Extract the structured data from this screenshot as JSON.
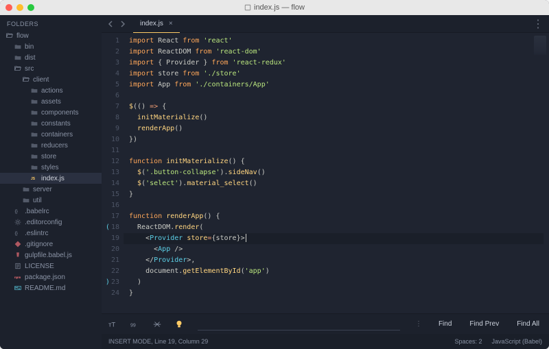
{
  "window": {
    "title": "index.js — flow"
  },
  "sidebar": {
    "header": "FOLDERS",
    "items": [
      {
        "label": "flow",
        "icon": "folder-open",
        "depth": 0,
        "sel": false
      },
      {
        "label": "bin",
        "icon": "folder",
        "depth": 1,
        "sel": false
      },
      {
        "label": "dist",
        "icon": "folder",
        "depth": 1,
        "sel": false
      },
      {
        "label": "src",
        "icon": "folder-open",
        "depth": 1,
        "sel": false
      },
      {
        "label": "client",
        "icon": "folder-open",
        "depth": 2,
        "sel": false
      },
      {
        "label": "actions",
        "icon": "folder",
        "depth": 3,
        "sel": false
      },
      {
        "label": "assets",
        "icon": "folder",
        "depth": 3,
        "sel": false
      },
      {
        "label": "components",
        "icon": "folder",
        "depth": 3,
        "sel": false
      },
      {
        "label": "constants",
        "icon": "folder",
        "depth": 3,
        "sel": false
      },
      {
        "label": "containers",
        "icon": "folder",
        "depth": 3,
        "sel": false
      },
      {
        "label": "reducers",
        "icon": "folder",
        "depth": 3,
        "sel": false
      },
      {
        "label": "store",
        "icon": "folder",
        "depth": 3,
        "sel": false
      },
      {
        "label": "styles",
        "icon": "folder",
        "depth": 3,
        "sel": false
      },
      {
        "label": "index.js",
        "icon": "js",
        "depth": 3,
        "sel": true
      },
      {
        "label": "server",
        "icon": "folder",
        "depth": 2,
        "sel": false
      },
      {
        "label": "util",
        "icon": "folder",
        "depth": 2,
        "sel": false
      },
      {
        "label": ".babelrc",
        "icon": "braces",
        "depth": 1,
        "sel": false
      },
      {
        "label": ".editorconfig",
        "icon": "gear",
        "depth": 1,
        "sel": false
      },
      {
        "label": ".eslintrc",
        "icon": "braces",
        "depth": 1,
        "sel": false
      },
      {
        "label": ".gitignore",
        "icon": "git",
        "depth": 1,
        "sel": false
      },
      {
        "label": "gulpfile.babel.js",
        "icon": "gulp",
        "depth": 1,
        "sel": false
      },
      {
        "label": "LICENSE",
        "icon": "license",
        "depth": 1,
        "sel": false
      },
      {
        "label": "package.json",
        "icon": "npm",
        "depth": 1,
        "sel": false
      },
      {
        "label": "README.md",
        "icon": "md",
        "depth": 1,
        "sel": false
      }
    ]
  },
  "tabs": {
    "active": {
      "label": "index.js"
    }
  },
  "code": {
    "lines": [
      [
        [
          "kw",
          "import"
        ],
        [
          "pn",
          " React "
        ],
        [
          "kw",
          "from"
        ],
        [
          "pn",
          " "
        ],
        [
          "str",
          "'react'"
        ]
      ],
      [
        [
          "kw",
          "import"
        ],
        [
          "pn",
          " ReactDOM "
        ],
        [
          "kw",
          "from"
        ],
        [
          "pn",
          " "
        ],
        [
          "str",
          "'react-dom'"
        ]
      ],
      [
        [
          "kw",
          "import"
        ],
        [
          "pn",
          " { Provider } "
        ],
        [
          "kw",
          "from"
        ],
        [
          "pn",
          " "
        ],
        [
          "str",
          "'react-redux'"
        ]
      ],
      [
        [
          "kw",
          "import"
        ],
        [
          "pn",
          " store "
        ],
        [
          "kw",
          "from"
        ],
        [
          "pn",
          " "
        ],
        [
          "str",
          "'./store'"
        ]
      ],
      [
        [
          "kw",
          "import"
        ],
        [
          "pn",
          " App "
        ],
        [
          "kw",
          "from"
        ],
        [
          "pn",
          " "
        ],
        [
          "str",
          "'./containers/App'"
        ]
      ],
      [],
      [
        [
          "fn",
          "$"
        ],
        [
          "pn",
          "(() "
        ],
        [
          "op",
          "=>"
        ],
        [
          "pn",
          " {"
        ]
      ],
      [
        [
          "pn",
          "  "
        ],
        [
          "fn",
          "initMaterialize"
        ],
        [
          "pn",
          "()"
        ]
      ],
      [
        [
          "pn",
          "  "
        ],
        [
          "fn",
          "renderApp"
        ],
        [
          "pn",
          "()"
        ]
      ],
      [
        [
          "pn",
          "})"
        ]
      ],
      [],
      [
        [
          "kw",
          "function"
        ],
        [
          "pn",
          " "
        ],
        [
          "fn",
          "initMaterialize"
        ],
        [
          "pn",
          "() {"
        ]
      ],
      [
        [
          "pn",
          "  "
        ],
        [
          "fn",
          "$"
        ],
        [
          "pn",
          "("
        ],
        [
          "str",
          "'.button-collapse'"
        ],
        [
          "pn",
          ")."
        ],
        [
          "fn",
          "sideNav"
        ],
        [
          "pn",
          "()"
        ]
      ],
      [
        [
          "pn",
          "  "
        ],
        [
          "fn",
          "$"
        ],
        [
          "pn",
          "("
        ],
        [
          "str",
          "'select'"
        ],
        [
          "pn",
          ")."
        ],
        [
          "fn",
          "material_select"
        ],
        [
          "pn",
          "()"
        ]
      ],
      [
        [
          "pn",
          "}"
        ]
      ],
      [],
      [
        [
          "kw",
          "function"
        ],
        [
          "pn",
          " "
        ],
        [
          "fn",
          "renderApp"
        ],
        [
          "pn",
          "() {"
        ]
      ],
      [
        [
          "pn",
          "  ReactDOM."
        ],
        [
          "fn",
          "render"
        ],
        [
          "pn",
          "("
        ]
      ],
      [
        [
          "pn",
          "    <"
        ],
        [
          "tag",
          "Provider"
        ],
        [
          "pn",
          " "
        ],
        [
          "attr",
          "store"
        ],
        [
          "op",
          "="
        ],
        [
          "pn",
          "{store}"
        ],
        [
          "pn",
          ">"
        ]
      ],
      [
        [
          "pn",
          "      <"
        ],
        [
          "tag",
          "App"
        ],
        [
          "pn",
          " />"
        ]
      ],
      [
        [
          "pn",
          "    </"
        ],
        [
          "tag",
          "Provider"
        ],
        [
          "pn",
          ">,"
        ]
      ],
      [
        [
          "pn",
          "    document."
        ],
        [
          "fn",
          "getElementById"
        ],
        [
          "pn",
          "("
        ],
        [
          "str",
          "'app'"
        ],
        [
          "pn",
          ")"
        ]
      ],
      [
        [
          "pn",
          "  )"
        ]
      ],
      [
        [
          "pn",
          "}"
        ]
      ]
    ],
    "line_numbers": [
      "1",
      "2",
      "3",
      "4",
      "5",
      "6",
      "7",
      "8",
      "9",
      "10",
      "11",
      "12",
      "13",
      "14",
      "15",
      "16",
      "17",
      "18",
      "19",
      "20",
      "21",
      "22",
      "23",
      "24"
    ],
    "bracket_lines": [
      18,
      23
    ],
    "highlight_line": 19
  },
  "findbar": {
    "find": "Find",
    "find_prev": "Find Prev",
    "find_all": "Find All"
  },
  "status": {
    "mode": "INSERT MODE, Line 19, Column 29",
    "spaces": "Spaces: 2",
    "lang": "JavaScript (Babel)"
  },
  "icons": {
    "folder": "#8a93a5",
    "folder-open": "#8a93a5",
    "js": "#ffcc66",
    "braces": "#8a93a5",
    "gear": "#8a93a5",
    "git": "#f07178",
    "gulp": "#f07178",
    "license": "#8a93a5",
    "npm": "#f07178",
    "md": "#5ccfe6"
  }
}
